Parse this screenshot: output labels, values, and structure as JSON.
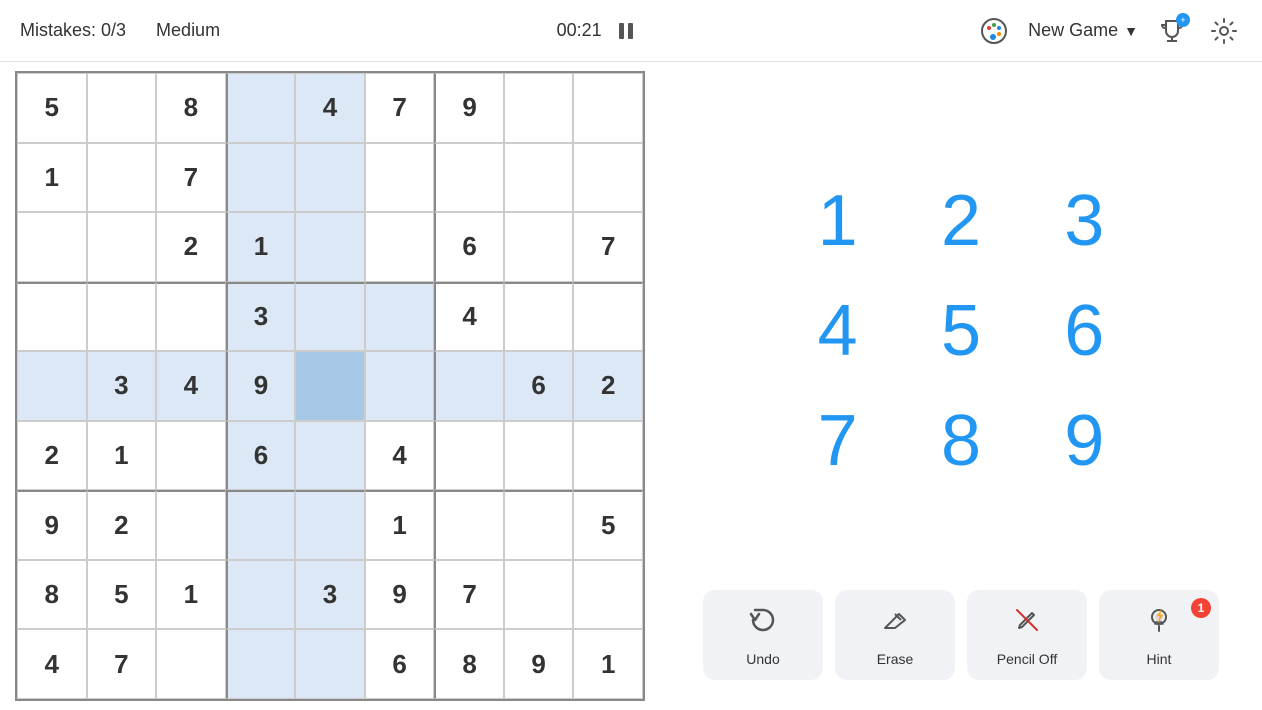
{
  "header": {
    "mistakes_label": "Mistakes: 0/3",
    "difficulty": "Medium",
    "timer": "00:21",
    "new_game_label": "New Game",
    "trophy_badge": "+",
    "chevron": "▼"
  },
  "grid": {
    "cells": [
      {
        "row": 0,
        "col": 0,
        "value": "5",
        "prefilled": true,
        "highlight": false
      },
      {
        "row": 0,
        "col": 1,
        "value": "",
        "prefilled": false,
        "highlight": false
      },
      {
        "row": 0,
        "col": 2,
        "value": "8",
        "prefilled": true,
        "highlight": false
      },
      {
        "row": 0,
        "col": 3,
        "value": "",
        "prefilled": false,
        "highlight": true
      },
      {
        "row": 0,
        "col": 4,
        "value": "4",
        "prefilled": true,
        "highlight": true
      },
      {
        "row": 0,
        "col": 5,
        "value": "7",
        "prefilled": true,
        "highlight": false
      },
      {
        "row": 0,
        "col": 6,
        "value": "9",
        "prefilled": true,
        "highlight": false
      },
      {
        "row": 0,
        "col": 7,
        "value": "",
        "prefilled": false,
        "highlight": false
      },
      {
        "row": 0,
        "col": 8,
        "value": "",
        "prefilled": false,
        "highlight": false
      },
      {
        "row": 1,
        "col": 0,
        "value": "1",
        "prefilled": true,
        "highlight": false
      },
      {
        "row": 1,
        "col": 1,
        "value": "",
        "prefilled": false,
        "highlight": false
      },
      {
        "row": 1,
        "col": 2,
        "value": "7",
        "prefilled": true,
        "highlight": false
      },
      {
        "row": 1,
        "col": 3,
        "value": "",
        "prefilled": false,
        "highlight": true
      },
      {
        "row": 1,
        "col": 4,
        "value": "",
        "prefilled": false,
        "highlight": true
      },
      {
        "row": 1,
        "col": 5,
        "value": "",
        "prefilled": false,
        "highlight": false
      },
      {
        "row": 1,
        "col": 6,
        "value": "",
        "prefilled": false,
        "highlight": false
      },
      {
        "row": 1,
        "col": 7,
        "value": "",
        "prefilled": false,
        "highlight": false
      },
      {
        "row": 1,
        "col": 8,
        "value": "",
        "prefilled": false,
        "highlight": false
      },
      {
        "row": 2,
        "col": 0,
        "value": "",
        "prefilled": false,
        "highlight": false
      },
      {
        "row": 2,
        "col": 1,
        "value": "",
        "prefilled": false,
        "highlight": false
      },
      {
        "row": 2,
        "col": 2,
        "value": "2",
        "prefilled": true,
        "highlight": false
      },
      {
        "row": 2,
        "col": 3,
        "value": "1",
        "prefilled": true,
        "highlight": true
      },
      {
        "row": 2,
        "col": 4,
        "value": "",
        "prefilled": false,
        "highlight": true
      },
      {
        "row": 2,
        "col": 5,
        "value": "",
        "prefilled": false,
        "highlight": false
      },
      {
        "row": 2,
        "col": 6,
        "value": "6",
        "prefilled": true,
        "highlight": false
      },
      {
        "row": 2,
        "col": 7,
        "value": "",
        "prefilled": false,
        "highlight": false
      },
      {
        "row": 2,
        "col": 8,
        "value": "7",
        "prefilled": true,
        "highlight": false
      },
      {
        "row": 3,
        "col": 0,
        "value": "",
        "prefilled": false,
        "highlight": false
      },
      {
        "row": 3,
        "col": 1,
        "value": "",
        "prefilled": false,
        "highlight": false
      },
      {
        "row": 3,
        "col": 2,
        "value": "",
        "prefilled": false,
        "highlight": false
      },
      {
        "row": 3,
        "col": 3,
        "value": "3",
        "prefilled": true,
        "highlight": true
      },
      {
        "row": 3,
        "col": 4,
        "value": "",
        "prefilled": false,
        "highlight": true
      },
      {
        "row": 3,
        "col": 5,
        "value": "",
        "prefilled": false,
        "highlight": true
      },
      {
        "row": 3,
        "col": 6,
        "value": "4",
        "prefilled": true,
        "highlight": false
      },
      {
        "row": 3,
        "col": 7,
        "value": "",
        "prefilled": false,
        "highlight": false
      },
      {
        "row": 3,
        "col": 8,
        "value": "",
        "prefilled": false,
        "highlight": false
      },
      {
        "row": 4,
        "col": 0,
        "value": "",
        "prefilled": false,
        "highlight": true
      },
      {
        "row": 4,
        "col": 1,
        "value": "3",
        "prefilled": true,
        "highlight": true
      },
      {
        "row": 4,
        "col": 2,
        "value": "4",
        "prefilled": true,
        "highlight": true
      },
      {
        "row": 4,
        "col": 3,
        "value": "9",
        "prefilled": true,
        "highlight": true
      },
      {
        "row": 4,
        "col": 4,
        "value": "",
        "prefilled": false,
        "highlight": false,
        "selected": true
      },
      {
        "row": 4,
        "col": 5,
        "value": "",
        "prefilled": false,
        "highlight": true
      },
      {
        "row": 4,
        "col": 6,
        "value": "",
        "prefilled": false,
        "highlight": true
      },
      {
        "row": 4,
        "col": 7,
        "value": "6",
        "prefilled": true,
        "highlight": true
      },
      {
        "row": 4,
        "col": 8,
        "value": "2",
        "prefilled": true,
        "highlight": true
      },
      {
        "row": 5,
        "col": 0,
        "value": "2",
        "prefilled": true,
        "highlight": false
      },
      {
        "row": 5,
        "col": 1,
        "value": "1",
        "prefilled": true,
        "highlight": false
      },
      {
        "row": 5,
        "col": 2,
        "value": "",
        "prefilled": false,
        "highlight": false
      },
      {
        "row": 5,
        "col": 3,
        "value": "6",
        "prefilled": true,
        "highlight": true
      },
      {
        "row": 5,
        "col": 4,
        "value": "",
        "prefilled": false,
        "highlight": true
      },
      {
        "row": 5,
        "col": 5,
        "value": "4",
        "prefilled": true,
        "highlight": false
      },
      {
        "row": 5,
        "col": 6,
        "value": "",
        "prefilled": false,
        "highlight": false
      },
      {
        "row": 5,
        "col": 7,
        "value": "",
        "prefilled": false,
        "highlight": false
      },
      {
        "row": 5,
        "col": 8,
        "value": "",
        "prefilled": false,
        "highlight": false
      },
      {
        "row": 6,
        "col": 0,
        "value": "9",
        "prefilled": true,
        "highlight": false
      },
      {
        "row": 6,
        "col": 1,
        "value": "2",
        "prefilled": true,
        "highlight": false
      },
      {
        "row": 6,
        "col": 2,
        "value": "",
        "prefilled": false,
        "highlight": false
      },
      {
        "row": 6,
        "col": 3,
        "value": "",
        "prefilled": false,
        "highlight": true
      },
      {
        "row": 6,
        "col": 4,
        "value": "",
        "prefilled": false,
        "highlight": true
      },
      {
        "row": 6,
        "col": 5,
        "value": "1",
        "prefilled": true,
        "highlight": false
      },
      {
        "row": 6,
        "col": 6,
        "value": "",
        "prefilled": false,
        "highlight": false
      },
      {
        "row": 6,
        "col": 7,
        "value": "",
        "prefilled": false,
        "highlight": false
      },
      {
        "row": 6,
        "col": 8,
        "value": "5",
        "prefilled": true,
        "highlight": false
      },
      {
        "row": 7,
        "col": 0,
        "value": "8",
        "prefilled": true,
        "highlight": false
      },
      {
        "row": 7,
        "col": 1,
        "value": "5",
        "prefilled": true,
        "highlight": false
      },
      {
        "row": 7,
        "col": 2,
        "value": "1",
        "prefilled": true,
        "highlight": false
      },
      {
        "row": 7,
        "col": 3,
        "value": "",
        "prefilled": false,
        "highlight": true
      },
      {
        "row": 7,
        "col": 4,
        "value": "3",
        "prefilled": true,
        "highlight": true
      },
      {
        "row": 7,
        "col": 5,
        "value": "9",
        "prefilled": true,
        "highlight": false
      },
      {
        "row": 7,
        "col": 6,
        "value": "7",
        "prefilled": true,
        "highlight": false
      },
      {
        "row": 7,
        "col": 7,
        "value": "",
        "prefilled": false,
        "highlight": false
      },
      {
        "row": 7,
        "col": 8,
        "value": "",
        "prefilled": false,
        "highlight": false
      },
      {
        "row": 8,
        "col": 0,
        "value": "4",
        "prefilled": true,
        "highlight": false
      },
      {
        "row": 8,
        "col": 1,
        "value": "7",
        "prefilled": true,
        "highlight": false
      },
      {
        "row": 8,
        "col": 2,
        "value": "",
        "prefilled": false,
        "highlight": false
      },
      {
        "row": 8,
        "col": 3,
        "value": "",
        "prefilled": false,
        "highlight": true
      },
      {
        "row": 8,
        "col": 4,
        "value": "",
        "prefilled": false,
        "highlight": true
      },
      {
        "row": 8,
        "col": 5,
        "value": "6",
        "prefilled": true,
        "highlight": false
      },
      {
        "row": 8,
        "col": 6,
        "value": "8",
        "prefilled": true,
        "highlight": false
      },
      {
        "row": 8,
        "col": 7,
        "value": "9",
        "prefilled": true,
        "highlight": false
      },
      {
        "row": 8,
        "col": 8,
        "value": "1",
        "prefilled": true,
        "highlight": false
      }
    ]
  },
  "numbers": [
    "1",
    "2",
    "3",
    "4",
    "5",
    "6",
    "7",
    "8",
    "9"
  ],
  "toolbar": {
    "undo_label": "Undo",
    "erase_label": "Erase",
    "pencil_label": "Pencil Off",
    "hint_label": "Hint",
    "hint_count": "1"
  }
}
